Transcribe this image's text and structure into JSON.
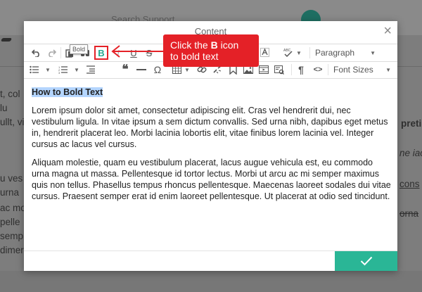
{
  "background": {
    "search_text": "Search Support",
    "left_lines": [
      "t, col",
      "lu",
      "ullt, vi",
      "u ves",
      "urna",
      "ac mo",
      "pelle",
      "semp",
      "dimer"
    ],
    "right_texts": [
      "preti",
      "ne iac",
      "cons",
      "orna"
    ]
  },
  "modal": {
    "title": "Content",
    "close_label": "×",
    "format_select": "Paragraph",
    "font_size_select": "Font Sizes",
    "bold_label": "B",
    "tooltip": "Bold",
    "heading": "How to Bold Text",
    "paragraphs": [
      "Lorem ipsum dolor sit amet, consectetur adipiscing elit. Cras vel hendrerit dui, nec vestibulum ligula. In vitae ipsum a sem dictum convallis. Sed urna nibh, dapibus eget metus in, hendrerit placerat leo. Morbi lacinia lobortis elit, vitae finibus lorem lacinia vel. Integer cursus ac lacus vel cursus.",
      "Aliquam molestie, quam eu vestibulum placerat, lacus augue vehicula est, eu commodo urna magna ut massa. Pellentesque id tortor lectus. Morbi ut arcu ac mi semper maximus quis non tellus. Phasellus tempus rhoncus pellentesque. Maecenas laoreet sodales dui vitae cursus. Praesent semper erat id enim laoreet pellentesque. Ut placerat at odio sed tincidunt."
    ],
    "confirm_icon": "check-icon"
  },
  "callout": {
    "pre": "Click the ",
    "bold": "B",
    "post": " icon",
    "line2": "to bold text"
  },
  "colors": {
    "accent": "#2ab696",
    "callout": "#e42127",
    "highlight": "#b4d5fe"
  }
}
